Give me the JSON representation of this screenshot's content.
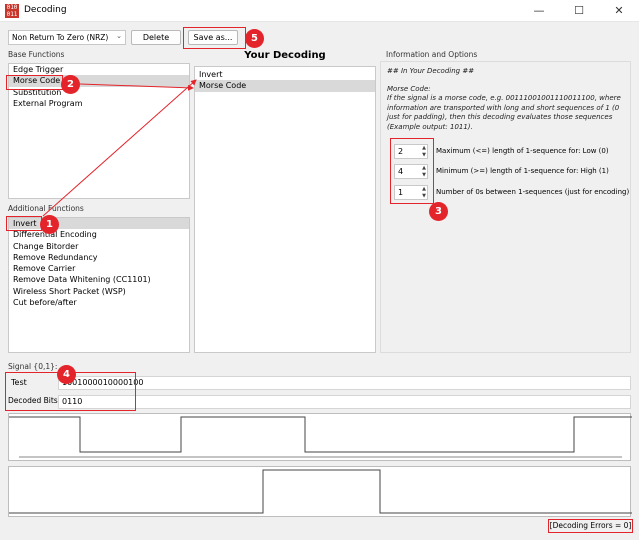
{
  "window": {
    "title": "Decoding",
    "minimize": "—",
    "maximize": "☐",
    "close": "✕",
    "app_icon_text": "010\n011"
  },
  "toolbar": {
    "combo_value": "Non Return To Zero (NRZ)",
    "delete_label": "Delete",
    "save_as_label": "Save as..."
  },
  "base_functions": {
    "label": "Base Functions",
    "items": [
      "Edge Trigger",
      "Morse Code",
      "Substitution",
      "External Program"
    ],
    "selected_index": 1
  },
  "additional_functions": {
    "label": "Additional Functions",
    "items": [
      "Invert",
      "Differential Encoding",
      "Change Bitorder",
      "Remove Redundancy",
      "Remove Carrier",
      "Remove Data Whitening (CC1101)",
      "Wireless Short Packet (WSP)",
      "Cut before/after"
    ],
    "selected_index": 0
  },
  "your_decoding": {
    "title": "Your Decoding",
    "items": [
      "Invert",
      "Morse Code"
    ],
    "selected_index": 1
  },
  "info": {
    "label": "Information and Options",
    "heading": "## In Your Decoding ##",
    "subheading": "Morse Code:",
    "description": "If the signal is a morse code, e.g. 00111001001110011100, where information are transported with long and short sequences of 1 (0 just for padding), then this decoding evaluates those sequences (Example output: 1011).",
    "options": [
      {
        "value": "2",
        "label": "Maximum (<=) length of 1-sequence for: Low (0)"
      },
      {
        "value": "4",
        "label": "Minimum (>=) length of 1-sequence for: High (1)"
      },
      {
        "value": "1",
        "label": "Number of 0s between 1-sequences (just for encoding)"
      }
    ]
  },
  "signal": {
    "label": "Signal {0,1}:",
    "name": "Test",
    "bits": "1001000010000100",
    "decoded_label": "Decoded Bits:",
    "decoded_value": "0110"
  },
  "status": {
    "text": "[Decoding Errors = 0]"
  },
  "badges": [
    "1",
    "2",
    "3",
    "4",
    "5"
  ],
  "colors": {
    "annotation_red": "#e3242b",
    "selection": "#d9d9d9",
    "signal_line": "#444444"
  }
}
